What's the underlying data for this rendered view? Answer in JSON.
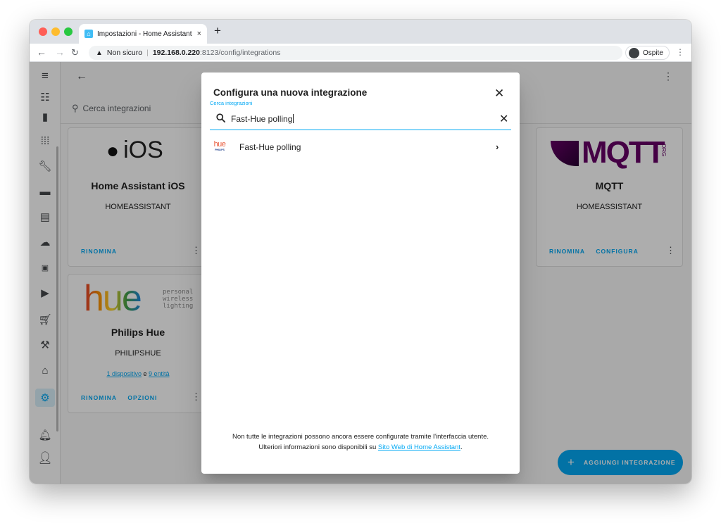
{
  "browser": {
    "tab_title": "Impostazioni - Home Assistant",
    "tab_close": "×",
    "new_tab": "+",
    "security_label": "Non sicuro",
    "url_host": "192.168.0.220",
    "url_rest": ":8123/config/integrations",
    "profile_label": "Ospite"
  },
  "page": {
    "search_placeholder": "Cerca integrazioni",
    "cards": [
      {
        "title": "Home Assistant iOS",
        "domain": "HOMEASSISTANT",
        "actions": [
          "RINOMINA"
        ],
        "logo_text": "iOS"
      },
      {
        "title": "MQTT",
        "domain": "HOMEASSISTANT",
        "actions": [
          "RINOMINA",
          "CONFIGURA"
        ],
        "logo_text": "MQTT",
        "logo_suffix": "ORG"
      },
      {
        "title": "Philips Hue",
        "domain": "PHILIPSHUE",
        "actions": [
          "RINOMINA",
          "OPZIONI"
        ],
        "logo_text": "hue",
        "logo_tagline": [
          "personal",
          "wireless",
          "lighting"
        ],
        "devices_link": "1 dispositivo",
        "and": "e",
        "entities_link": "9 entità"
      }
    ],
    "add_button_label": "AGGIUNGI INTEGRAZIONE"
  },
  "dialog": {
    "title": "Configura una nuova integrazione",
    "search_label": "Cerca integrazioni",
    "search_value": "Fast-Hue polling",
    "results": [
      {
        "name": "Fast-Hue polling",
        "logo_text": "hue",
        "logo_sub": "PHILIPS"
      }
    ],
    "footer_line1": "Non tutte le integrazioni possono ancora essere configurate tramite l'interfaccia utente.",
    "footer_line2_prefix": "Ulteriori informazioni sono disponibili su",
    "footer_link": "Sito Web di Home Assistant",
    "footer_suffix": "."
  },
  "icons": [
    "menu-icon",
    "back-arrow-icon",
    "search-icon",
    "close-icon",
    "chevron-right-icon",
    "dots-vertical-icon",
    "plus-icon"
  ],
  "colors": {
    "accent": "#03a9f4",
    "scrim": "rgba(0,0,0,0.32)"
  }
}
